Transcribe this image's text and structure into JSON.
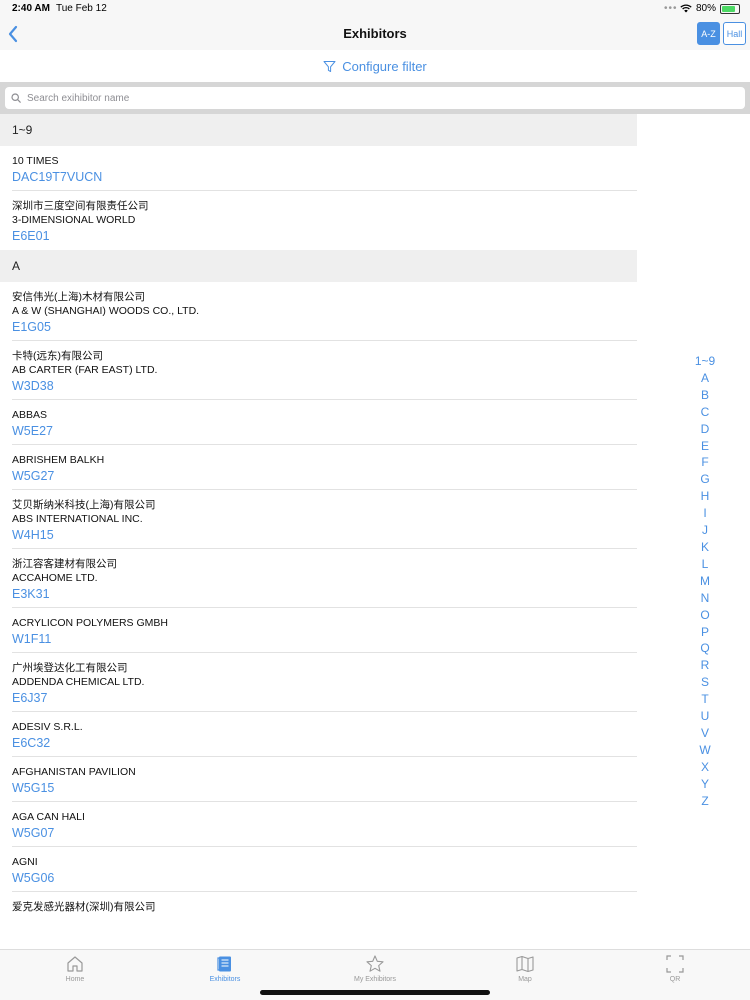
{
  "status": {
    "time": "2:40 AM",
    "date": "Tue Feb 12",
    "battery": "80%",
    "battery_level": 0.8
  },
  "nav": {
    "title": "Exhibitors",
    "seg_az": "A-Z",
    "seg_hall": "Hall"
  },
  "filter": {
    "label": "Configure filter"
  },
  "search": {
    "placeholder": "Search exihibitor name",
    "value": ""
  },
  "sections": [
    {
      "title": "1~9",
      "items": [
        {
          "lines": [
            "10 TIMES"
          ],
          "code": "DAC19T7VUCN"
        },
        {
          "lines": [
            "深圳市三度空间有限责任公司",
            "3-DIMENSIONAL WORLD"
          ],
          "code": "E6E01"
        }
      ]
    },
    {
      "title": "A",
      "items": [
        {
          "lines": [
            "安信伟光(上海)木材有限公司",
            "A & W (SHANGHAI) WOODS CO., LTD."
          ],
          "code": "E1G05"
        },
        {
          "lines": [
            "卡特(远东)有限公司",
            "AB CARTER (FAR EAST) LTD."
          ],
          "code": "W3D38"
        },
        {
          "lines": [
            "ABBAS"
          ],
          "code": "W5E27"
        },
        {
          "lines": [
            "ABRISHEM BALKH"
          ],
          "code": "W5G27"
        },
        {
          "lines": [
            "艾贝斯纳米科技(上海)有限公司",
            "ABS INTERNATIONAL INC."
          ],
          "code": "W4H15"
        },
        {
          "lines": [
            "浙江容客建材有限公司",
            "ACCAHOME LTD."
          ],
          "code": "E3K31"
        },
        {
          "lines": [
            "ACRYLICON POLYMERS GMBH"
          ],
          "code": "W1F11"
        },
        {
          "lines": [
            "广州埃登达化工有限公司",
            "ADDENDA CHEMICAL LTD."
          ],
          "code": "E6J37"
        },
        {
          "lines": [
            "ADESIV S.R.L."
          ],
          "code": "E6C32"
        },
        {
          "lines": [
            "AFGHANISTAN PAVILION"
          ],
          "code": "W5G15"
        },
        {
          "lines": [
            "AGA CAN HALI"
          ],
          "code": "W5G07"
        },
        {
          "lines": [
            "AGNI"
          ],
          "code": "W5G06"
        },
        {
          "lines": [
            "爱克发感光器材(深圳)有限公司"
          ],
          "code": ""
        }
      ]
    }
  ],
  "index": [
    "1~9",
    "A",
    "B",
    "C",
    "D",
    "E",
    "F",
    "G",
    "H",
    "I",
    "J",
    "K",
    "L",
    "M",
    "N",
    "O",
    "P",
    "Q",
    "R",
    "S",
    "T",
    "U",
    "V",
    "W",
    "X",
    "Y",
    "Z"
  ],
  "tabs": [
    {
      "label": "Home",
      "icon": "home-icon",
      "active": false
    },
    {
      "label": "Exhibitors",
      "icon": "book-icon",
      "active": true
    },
    {
      "label": "My Exhibitors",
      "icon": "star-icon",
      "active": false
    },
    {
      "label": "Map",
      "icon": "map-icon",
      "active": false
    },
    {
      "label": "QR",
      "icon": "qr-scan-icon",
      "active": false
    }
  ],
  "colors": {
    "accent": "#4a90e2",
    "section_bg": "#efefef",
    "inactive": "#999999"
  }
}
